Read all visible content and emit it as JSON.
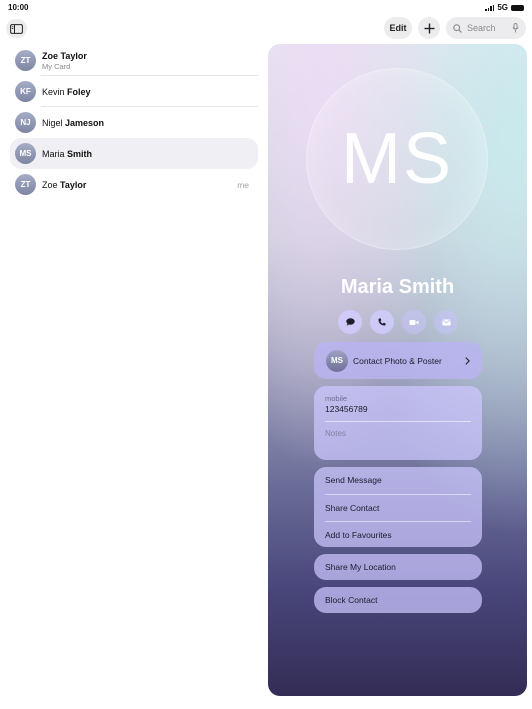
{
  "status_bar": {
    "time": "10:00",
    "network": "5G"
  },
  "toolbar": {
    "edit_label": "Edit",
    "search_placeholder": "Search"
  },
  "contacts": [
    {
      "initials": "ZT",
      "first": "Zoe",
      "last": "Taylor",
      "subtitle": "My Card",
      "first_bold": true,
      "selected": false,
      "tag": ""
    },
    {
      "initials": "KF",
      "first": "Kevin",
      "last": "Foley",
      "subtitle": "",
      "first_bold": false,
      "selected": false,
      "tag": ""
    },
    {
      "initials": "NJ",
      "first": "Nigel",
      "last": "Jameson",
      "subtitle": "",
      "first_bold": false,
      "selected": false,
      "tag": ""
    },
    {
      "initials": "MS",
      "first": "Maria",
      "last": "Smith",
      "subtitle": "",
      "first_bold": false,
      "selected": true,
      "tag": ""
    },
    {
      "initials": "ZT",
      "first": "Zoe",
      "last": "Taylor",
      "subtitle": "",
      "first_bold": false,
      "selected": false,
      "tag": "me"
    }
  ],
  "card": {
    "initials": "MS",
    "name": "Maria Smith",
    "actions": [
      "message-icon",
      "phone-icon",
      "video-icon",
      "mail-icon"
    ],
    "poster": {
      "initials": "MS",
      "label": "Contact Photo & Poster"
    },
    "phone": {
      "label": "mobile",
      "value": "123456789"
    },
    "notes_label": "Notes",
    "group_items": [
      "Send Message",
      "Share Contact",
      "Add to Favourites"
    ],
    "share_location": "Share My Location",
    "block_contact": "Block Contact"
  }
}
